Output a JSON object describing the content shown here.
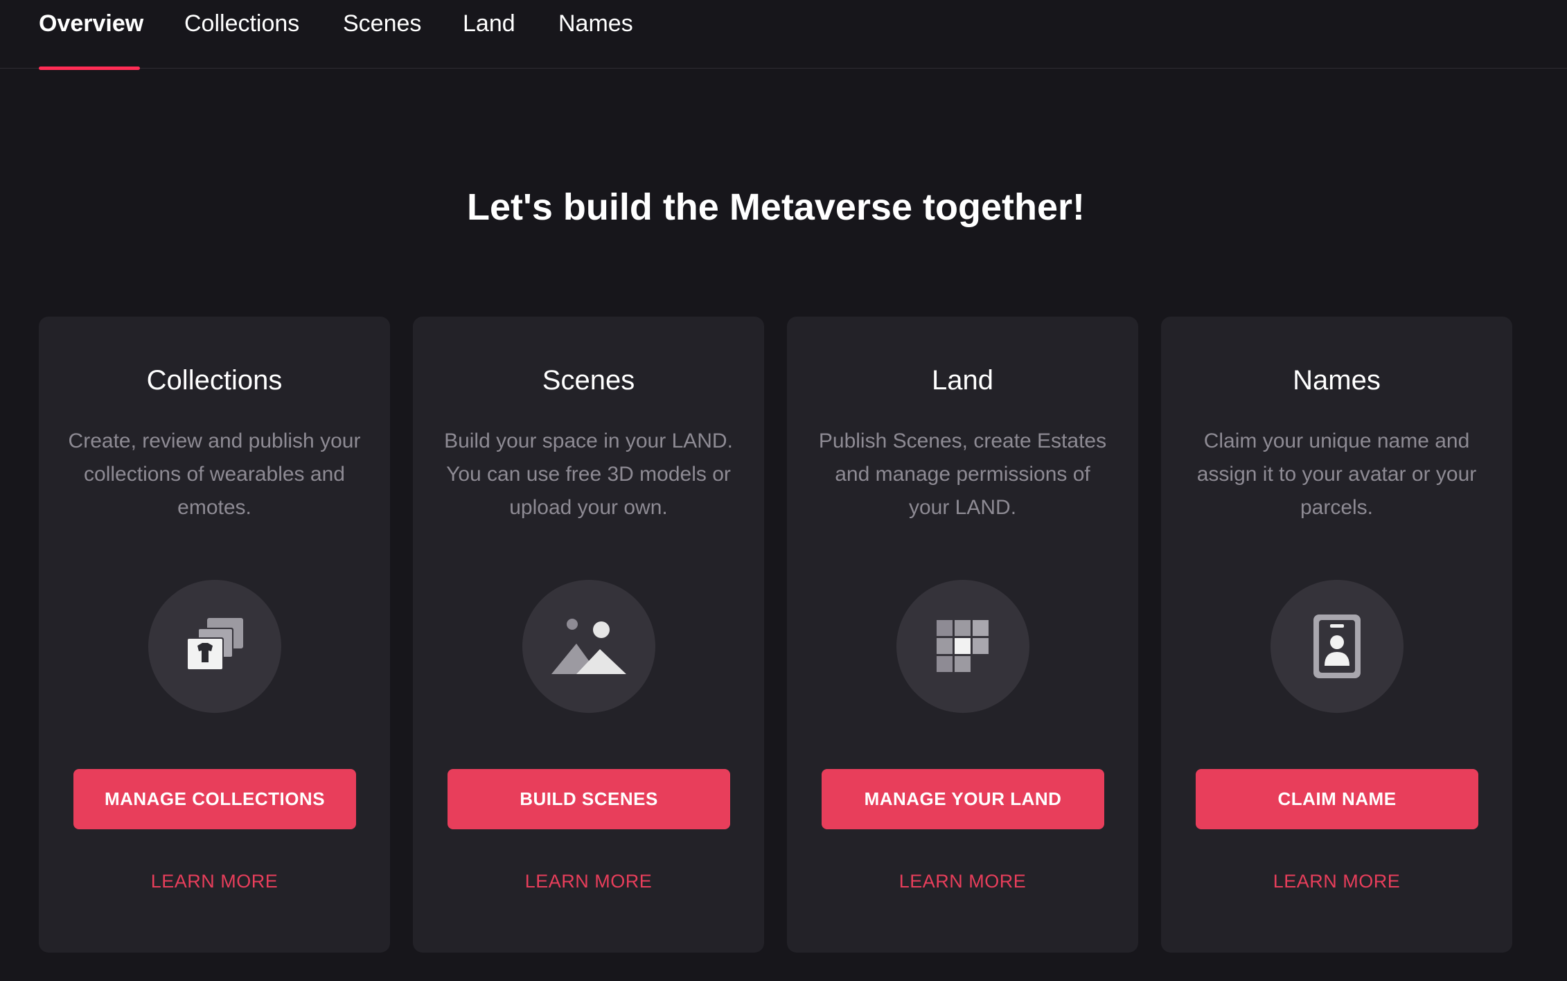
{
  "nav": {
    "tabs": [
      {
        "label": "Overview",
        "active": true
      },
      {
        "label": "Collections",
        "active": false
      },
      {
        "label": "Scenes",
        "active": false
      },
      {
        "label": "Land",
        "active": false
      },
      {
        "label": "Names",
        "active": false
      }
    ]
  },
  "hero": {
    "title": "Let's build the Metaverse together!"
  },
  "cards": [
    {
      "title": "Collections",
      "description": "Create, review and publish your collections of wearables and emotes.",
      "icon": "collections-icon",
      "button_label": "MANAGE COLLECTIONS",
      "link_label": "LEARN MORE"
    },
    {
      "title": "Scenes",
      "description": "Build your space in your LAND. You can use free 3D models or upload your own.",
      "icon": "scenes-icon",
      "button_label": "BUILD SCENES",
      "link_label": "LEARN MORE"
    },
    {
      "title": "Land",
      "description": "Publish Scenes, create Estates and manage permissions of your LAND.",
      "icon": "land-icon",
      "button_label": "MANAGE YOUR LAND",
      "link_label": "LEARN MORE"
    },
    {
      "title": "Names",
      "description": "Claim your unique name and assign it to your avatar or your parcels.",
      "icon": "names-icon",
      "button_label": "CLAIM NAME",
      "link_label": "LEARN MORE"
    }
  ],
  "colors": {
    "background": "#17161b",
    "card": "#232228",
    "accent": "#e83e5b",
    "tab_indicator": "#ff2d55",
    "muted_text": "#8e8b94"
  }
}
